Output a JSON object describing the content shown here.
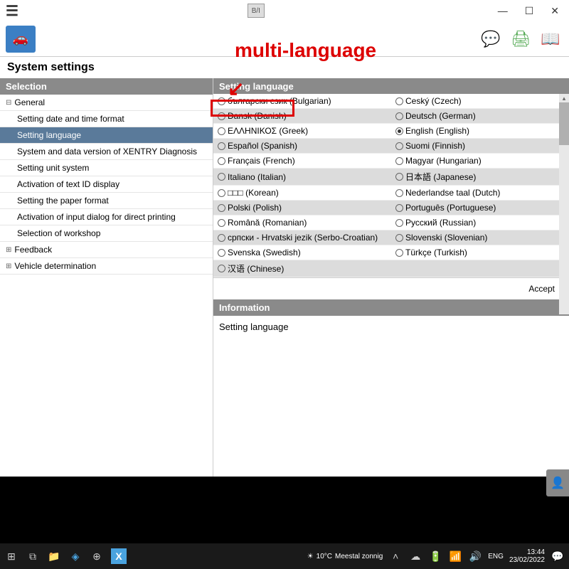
{
  "titlebar": {
    "icon_label": "B/I"
  },
  "toolbar": {
    "car_icon": "🚗",
    "chat_icon": "💬",
    "print_icon": "🖨",
    "book_icon": "📖"
  },
  "page_title": "System settings",
  "sidebar": {
    "header": "Selection",
    "groups": [
      {
        "label": "General",
        "expanded": true,
        "children": [
          "Setting date and time format",
          "Setting language",
          "System and data version of XENTRY Diagnosis",
          "Setting unit system",
          "Activation of text ID display",
          "Setting the paper format",
          "Activation of input dialog for direct printing",
          "Selection of workshop"
        ]
      },
      {
        "label": "Feedback",
        "expanded": false
      },
      {
        "label": "Vehicle determination",
        "expanded": false
      }
    ],
    "selected": "Setting language"
  },
  "content": {
    "header": "Setting language",
    "languages": [
      [
        "български език (Bulgarian)",
        "Ceský (Czech)"
      ],
      [
        "Dansk (Danish)",
        "Deutsch (German)"
      ],
      [
        "ΕΛΛΗΝΙΚΟΣ (Greek)",
        "English (English)"
      ],
      [
        "Español (Spanish)",
        "Suomi (Finnish)"
      ],
      [
        "Français (French)",
        "Magyar (Hungarian)"
      ],
      [
        "Italiano (Italian)",
        "日本語 (Japanese)"
      ],
      [
        "□□□ (Korean)",
        "Nederlandse taal (Dutch)"
      ],
      [
        "Polski (Polish)",
        "Português (Portuguese)"
      ],
      [
        "Română (Romanian)",
        "Русский (Russian)"
      ],
      [
        "српски - Hrvatski jezik (Serbo-Croatian)",
        "Slovenski (Slovenian)"
      ],
      [
        "Svenska (Swedish)",
        "Türkçe (Turkish)"
      ],
      [
        "汉语 (Chinese)",
        ""
      ]
    ],
    "selected_language": "English (English)",
    "accept_label": "Accept",
    "info_header": "Information",
    "info_body": "Setting language"
  },
  "annotation": {
    "text": "multi-language",
    "arrow": "↙"
  },
  "taskbar": {
    "weather_temp": "10°C",
    "weather_text": "Meestal zonnig",
    "lang": "ENG",
    "time": "13:44",
    "date": "23/02/2022"
  }
}
